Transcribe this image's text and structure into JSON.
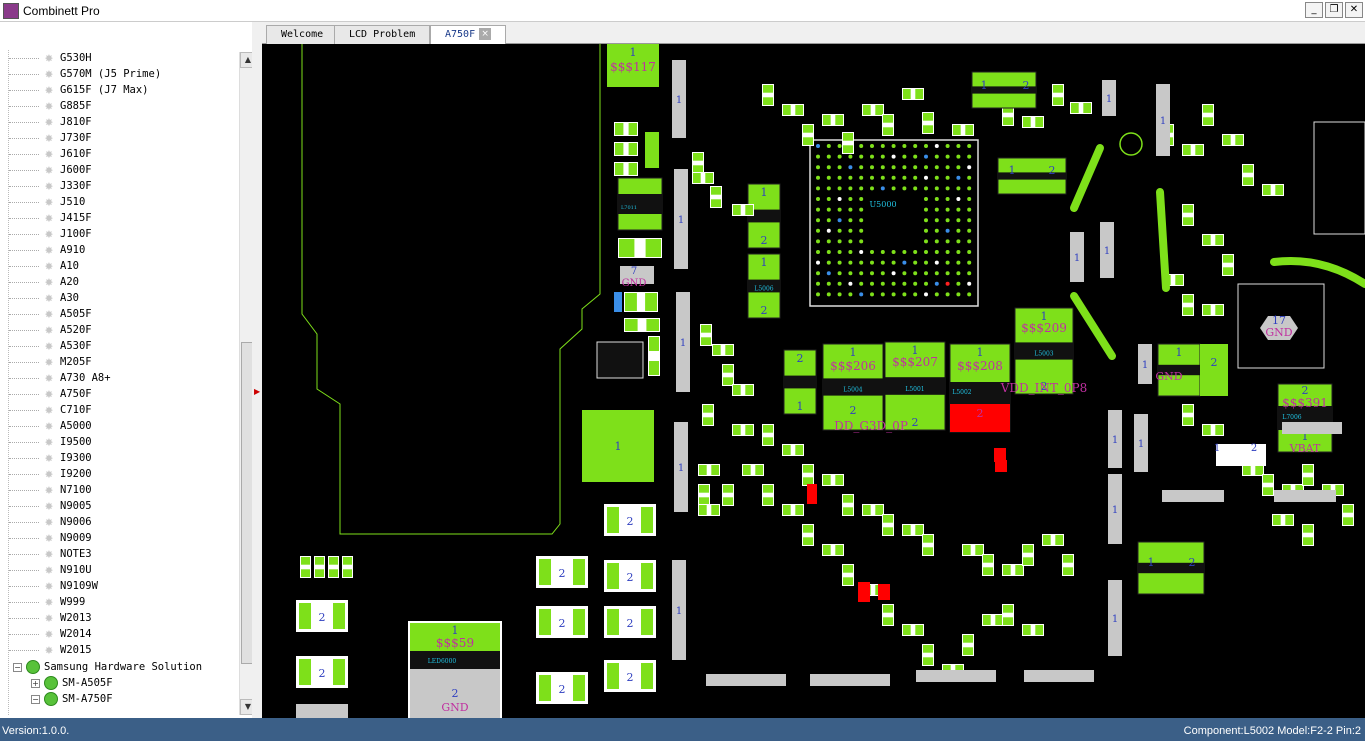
{
  "app": {
    "title": "Combinett Pro",
    "icon": "combinett-logo-icon"
  },
  "window_controls": {
    "minimize": "_",
    "restore": "❐",
    "close": "✕"
  },
  "tabs": [
    {
      "label": "Welcome"
    },
    {
      "label": "LCD Problem"
    },
    {
      "label": "A750F",
      "active": true,
      "close": "×"
    }
  ],
  "sidebar": {
    "models": [
      "G530H",
      "G570M (J5 Prime)",
      "G615F (J7 Max)",
      "G885F",
      "J810F",
      "J730F",
      "J610F",
      "J600F",
      "J330F",
      "J510",
      "J415F",
      "J100F",
      "A910",
      "A10",
      "A20",
      "A30",
      "A505F",
      "A520F",
      "A530F",
      "M205F",
      "A730 A8+",
      "A750F",
      "C710F",
      "A5000",
      "I9500",
      "I9300",
      "I9200",
      "N7100",
      "N9005",
      "N9006",
      "N9009",
      "NOTE3",
      "N910U",
      "N9109W",
      "W999",
      "W2013",
      "W2014",
      "W2015"
    ],
    "group": {
      "expander": "−",
      "label": "Samsung Hardware Solution"
    },
    "subitems": [
      {
        "expander": "+",
        "label": "SM-A505F"
      },
      {
        "expander": "−",
        "label": "SM-A750F"
      }
    ]
  },
  "board": {
    "labels": {
      "s117": "$$$117",
      "s59": "$$$59",
      "s206": "$$$206",
      "s207": "$$$207",
      "s208": "$$$208",
      "s209": "$$$209",
      "s391": "$$$391",
      "gnd": "GND",
      "vdd_g3d": "DD_G3D_0P",
      "vdd_int": "VDD_INT_0P8",
      "vbat": "VBAT",
      "u5000": "U5000",
      "l5002": "L5002",
      "l5001": "L5001",
      "l5004": "L5004",
      "l5003": "L5003",
      "l7006": "L7006",
      "led6000": "LED6000",
      "l7011": "L7011",
      "l5006": "L5006"
    },
    "colors": {
      "background": "#000000",
      "pad": "#7ee01a",
      "body": "#c8c8c8",
      "highlight": "#ff0000",
      "outline": "#7ee01a",
      "pin_label": "#3040c0",
      "net_label": "#c030a0",
      "ref_label": "#20c0e0"
    }
  },
  "status": {
    "version": "Version:1.0.0.",
    "component": "Component:L5002 Model:F2-2 Pin:2"
  }
}
